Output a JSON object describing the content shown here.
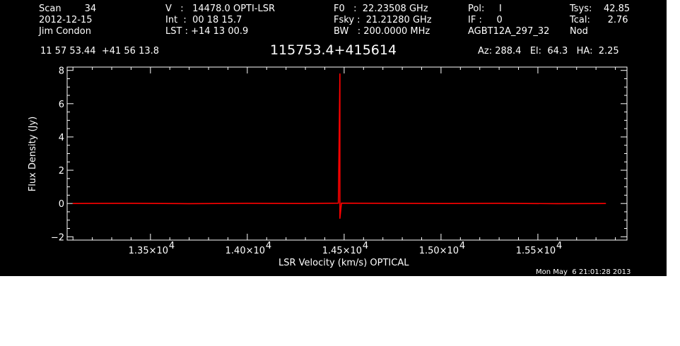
{
  "header": {
    "col1": [
      "Scan        34",
      "2012-12-15",
      "Jim Condon"
    ],
    "col2": [
      "V   :   14478.0 OPTI-LSR",
      "Int  :  00 18 15.7",
      "LST : +14 13 00.9"
    ],
    "col3": [
      "F0   :  22.23508 GHz",
      "Fsky :  21.21280 GHz",
      "BW   : 200.0000 MHz"
    ],
    "col4": [
      "Pol:     I",
      "IF :     0",
      "AGBT12A_297_32"
    ],
    "col5": [
      "Tsys:    42.85",
      "Tcal:      2.76",
      "Nod"
    ],
    "coords": "11 57 53.44  +41 56 13.8",
    "source": "115753.4+415614",
    "pointing": "Az: 288.4   El:  64.3   HA:  2.25"
  },
  "footer": {
    "date": "Mon May  6 21:01:28 2013"
  },
  "colors": {
    "background": "#000000",
    "axes": "#ffffff",
    "spectrum": "#ff0000"
  },
  "chart_data": {
    "type": "line",
    "xlabel": "LSR Velocity (km/s) OPTICAL",
    "ylabel": "Flux Density (Jy)",
    "xlim": [
      13070,
      15960
    ],
    "ylim": [
      -2.2,
      8.2
    ],
    "x_ticks": [
      {
        "value": 13500,
        "label": "1.35×10",
        "exp": "4"
      },
      {
        "value": 14000,
        "label": "1.40×10",
        "exp": "4"
      },
      {
        "value": 14500,
        "label": "1.45×10",
        "exp": "4"
      },
      {
        "value": 15000,
        "label": "1.50×10",
        "exp": "4"
      },
      {
        "value": 15500,
        "label": "1.55×10",
        "exp": "4"
      }
    ],
    "y_ticks": [
      {
        "value": -2,
        "label": "−2"
      },
      {
        "value": 0,
        "label": "0"
      },
      {
        "value": 2,
        "label": "2"
      },
      {
        "value": 4,
        "label": "4"
      },
      {
        "value": 6,
        "label": "6"
      },
      {
        "value": 8,
        "label": "8"
      }
    ],
    "series": [
      {
        "x": [
          13100,
          13400,
          13700,
          14000,
          14300,
          14470,
          14478,
          14478,
          14486,
          14700,
          15000,
          15300,
          15600,
          15850
        ],
        "y": [
          0.0,
          0.01,
          -0.01,
          0.01,
          0.0,
          0.02,
          7.8,
          -0.9,
          0.02,
          0.01,
          0.0,
          0.01,
          -0.01,
          0.0
        ]
      }
    ]
  }
}
